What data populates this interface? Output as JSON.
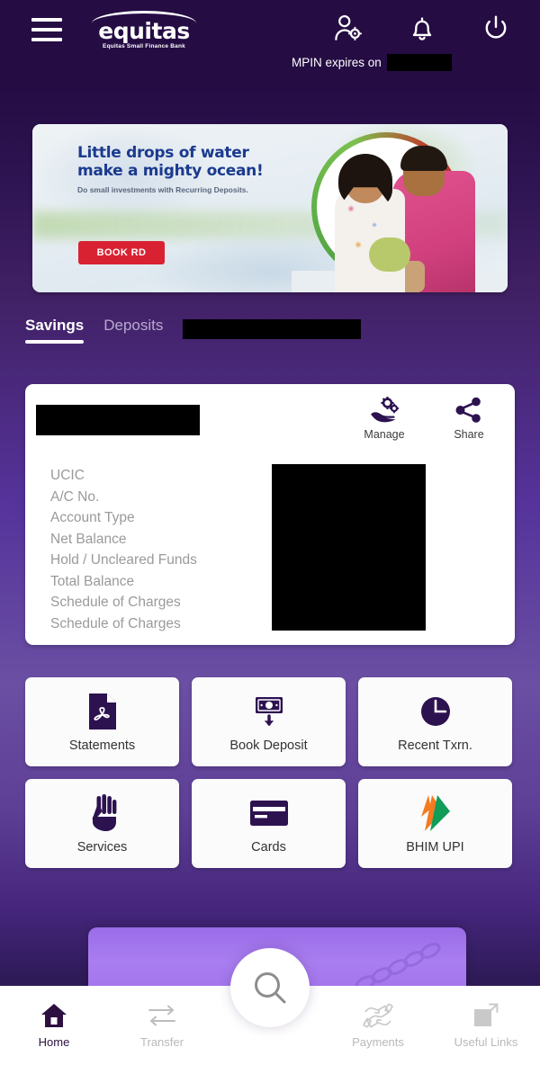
{
  "header": {
    "menu_icon": "hamburger-menu-icon",
    "logo_word": "equitas",
    "logo_tagline": "Equitas Small Finance Bank",
    "profile_icon": "profile-settings-icon",
    "notification_icon": "bell-icon",
    "logout_icon": "power-logout-icon",
    "mpin_text": "MPIN expires on",
    "mpin_value_redacted": ""
  },
  "banner": {
    "title_line1": "Little drops of water",
    "title_line2": "make a mighty ocean!",
    "subtitle": "Do small investments with Recurring Deposits.",
    "cta_label": "BOOK RD",
    "cta_color": "#d92231",
    "title_color": "#1b3a8f",
    "image_alt": "father-and-daughter-with-piggy-bank"
  },
  "tabs": [
    {
      "label": "Savings",
      "active": true
    },
    {
      "label": "Deposits",
      "active": false
    },
    {
      "label": "",
      "active": false,
      "redacted": true
    }
  ],
  "account_card": {
    "account_name_redacted": "",
    "actions": [
      {
        "label": "Manage",
        "icon": "hand-gears-icon"
      },
      {
        "label": "Share",
        "icon": "share-icon"
      }
    ],
    "labels": [
      "UCIC",
      "A/C No.",
      "Account Type",
      "Net Balance",
      "Hold / Uncleared Funds",
      "Total Balance",
      "Schedule of Charges",
      "Schedule of Charges"
    ],
    "values_redacted": ""
  },
  "quick_actions": [
    {
      "label": "Statements",
      "icon": "pdf-document-icon"
    },
    {
      "label": "Book Deposit",
      "icon": "banknote-download-icon"
    },
    {
      "label": "Recent Txrn.",
      "icon": "clock-icon"
    },
    {
      "label": "Services",
      "icon": "hand-icon"
    },
    {
      "label": "Cards",
      "icon": "credit-card-icon"
    },
    {
      "label": "BHIM UPI",
      "icon": "bhim-upi-logo-icon"
    }
  ],
  "search_fab": {
    "icon": "search-icon"
  },
  "bottom_nav": [
    {
      "label": "Home",
      "icon": "home-icon",
      "active": true
    },
    {
      "label": "Transfer",
      "icon": "transfer-arrows-icon",
      "active": false
    },
    {
      "label": "Payments",
      "icon": "payments-hands-icon",
      "active": false
    },
    {
      "label": "Useful Links",
      "icon": "external-link-icon",
      "active": false
    }
  ],
  "colors": {
    "brand_purple": "#2c1040",
    "background_dark": "#250c43",
    "background_mid": "#6a4fa3",
    "accent_red": "#d92231",
    "upi_orange": "#f47b20",
    "upi_green": "#0f9d58",
    "card_white": "#ffffff",
    "peek_card_purple": "#a97ef0"
  }
}
